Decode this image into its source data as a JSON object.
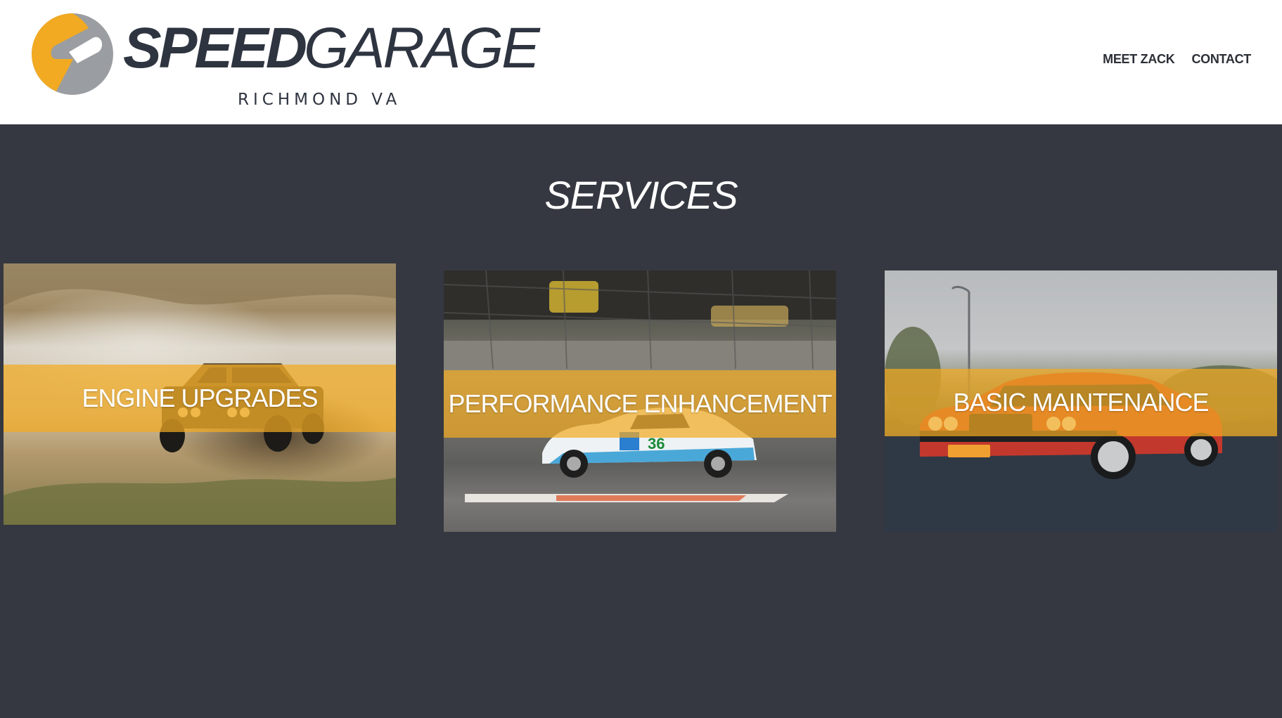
{
  "brand": {
    "name_bold": "SPEED",
    "name_light": "GARAGE",
    "location": "RICHMOND VA",
    "colors": {
      "orange": "#F2AA22",
      "gray": "#9A9DA1",
      "dark": "#2E3440"
    }
  },
  "nav": {
    "items": [
      {
        "label": "MEET ZACK"
      },
      {
        "label": "CONTACT"
      }
    ]
  },
  "services": {
    "title": "SERVICES",
    "cards": [
      {
        "label": "ENGINE UPGRADES",
        "image": "rally-car-dust-photo"
      },
      {
        "label": "PERFORMANCE ENHANCEMENT",
        "image": "race-car-track-photo"
      },
      {
        "label": "BASIC MAINTENANCE",
        "image": "red-bmw-photo"
      }
    ]
  },
  "colors": {
    "background": "#353840",
    "header": "#FFFFFF",
    "band": "#F2AA22"
  }
}
